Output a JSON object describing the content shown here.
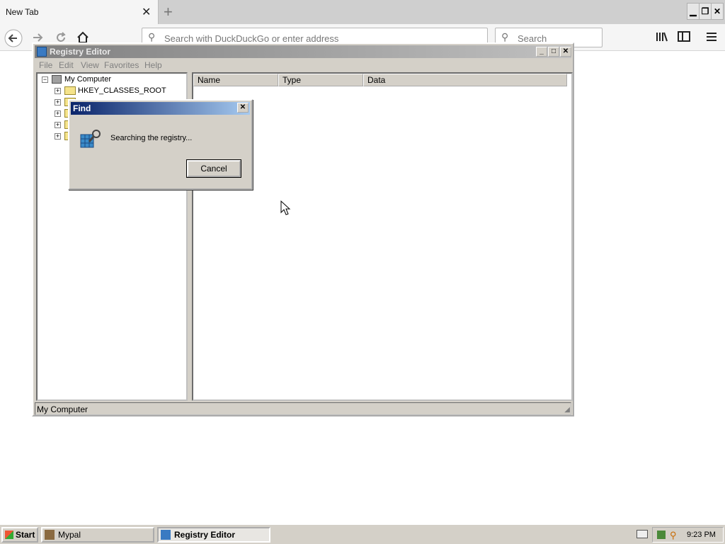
{
  "browser": {
    "tab_title": "New Tab",
    "tab_close": "✕",
    "new_tab": "+",
    "address_placeholder": "Search with DuckDuckGo or enter address",
    "search_placeholder": "Search",
    "window_buttons": {
      "minimize": "▁",
      "restore": "❐",
      "close": "✕"
    },
    "icons": [
      "back-icon",
      "forward-icon",
      "reload-icon",
      "home-icon",
      "library-icon",
      "sidebar-icon",
      "menu-icon"
    ]
  },
  "regedit": {
    "title": "Registry Editor",
    "menu": [
      "File",
      "Edit",
      "View",
      "Favorites",
      "Help"
    ],
    "tree": {
      "root": "My Computer",
      "items": [
        "HKEY_CLASSES_ROOT"
      ]
    },
    "columns": [
      "Name",
      "Type",
      "Data"
    ],
    "status": "My Computer",
    "title_buttons": {
      "minimize": "_",
      "maximize": "□",
      "close": "✕"
    }
  },
  "find_dialog": {
    "title": "Find",
    "message": "Searching the registry...",
    "cancel": "Cancel",
    "close": "✕"
  },
  "taskbar": {
    "start": "Start",
    "buttons": [
      "Mypal",
      "Registry Editor"
    ],
    "active_button": "Registry Editor",
    "clock": "9:23 PM"
  }
}
